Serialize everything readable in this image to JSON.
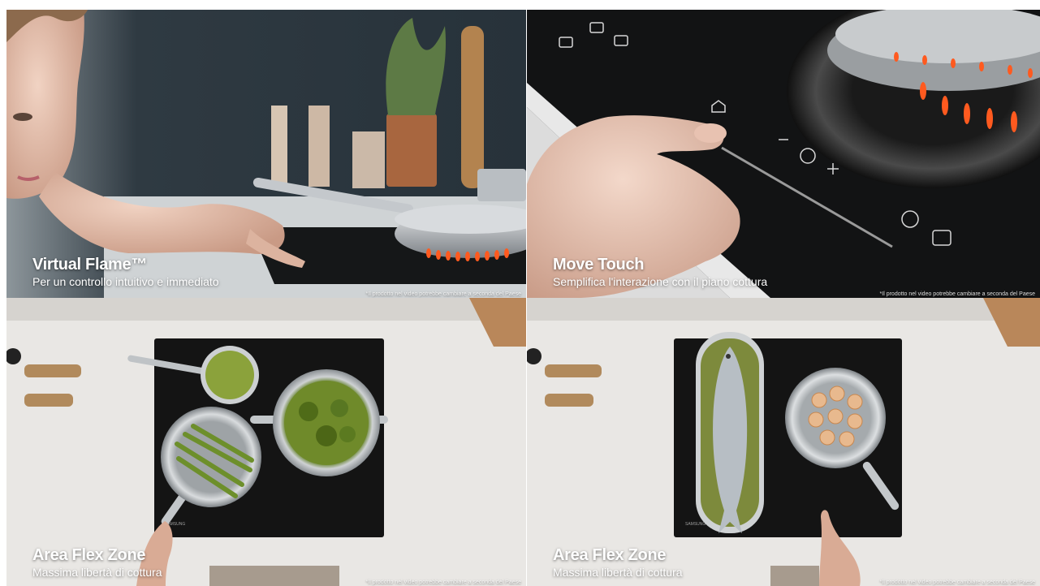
{
  "panels": [
    {
      "title": "Virtual Flame™",
      "subtitle": "Per un controllo intuitivo e immediato",
      "disclaimer": "*Il prodotto nel video potrebbe cambiare a seconda del Paese"
    },
    {
      "title": "Move Touch",
      "subtitle": "Semplifica l'interazione con il piano cottura",
      "disclaimer": "*Il prodotto nel video potrebbe cambiare a seconda del Paese"
    },
    {
      "title": "Area Flex Zone",
      "subtitle": "Massima libertà di cottura",
      "disclaimer": "*Il prodotto nel video potrebbe cambiare a seconda del Paese"
    },
    {
      "title": "Area Flex Zone",
      "subtitle": "Massima libertà di cottura",
      "disclaimer": "*Il prodotto nel video potrebbe cambiare a seconda del Paese"
    }
  ],
  "brand": {
    "cooktop_logo": "SAMSUNG"
  },
  "colors": {
    "flame": "#ff5a1f",
    "cooktop": "#141414",
    "countertop": "#e9e7e4",
    "caption_text": "#ffffff"
  }
}
